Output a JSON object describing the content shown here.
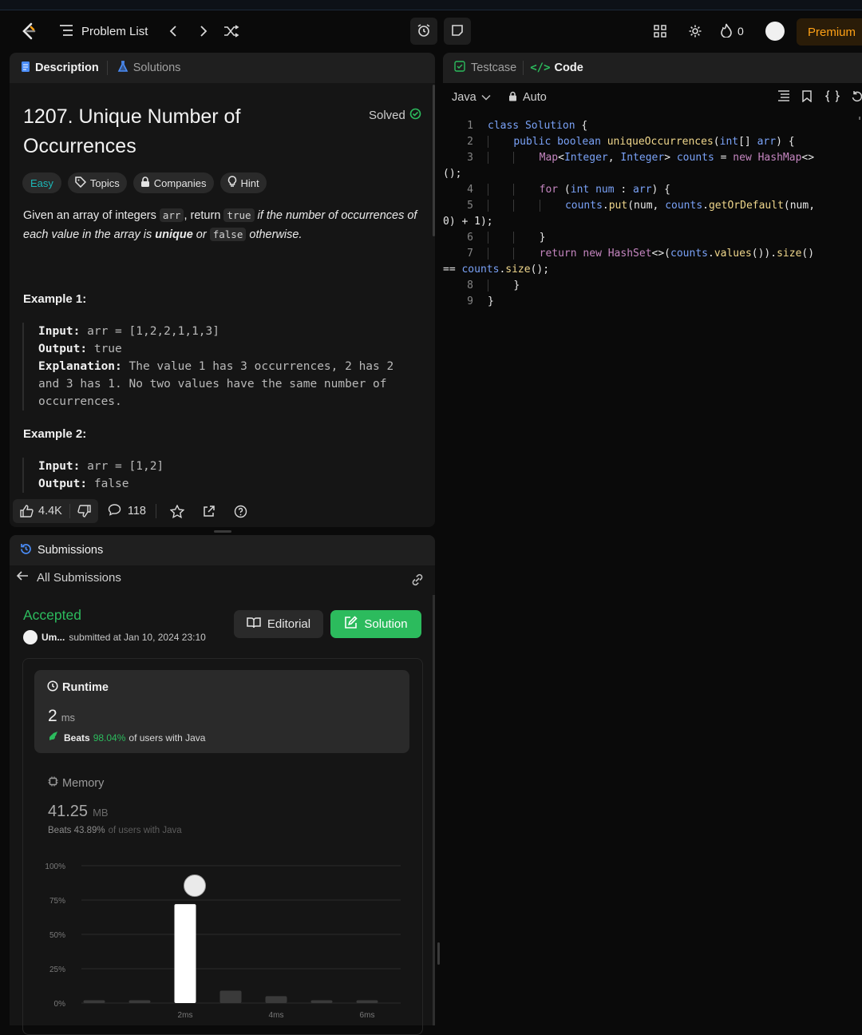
{
  "nav": {
    "problem_list": "Problem List",
    "streak_count": "0",
    "premium": "Premium"
  },
  "left_tabs": {
    "description": "Description",
    "solutions": "Solutions"
  },
  "problem": {
    "title": "1207. Unique Number of Occurrences",
    "status": "Solved",
    "difficulty": "Easy",
    "chips": [
      "Topics",
      "Companies",
      "Hint"
    ],
    "desc": {
      "p1": "Given an array of integers ",
      "c1": "arr",
      "p2": ", return ",
      "c2": "true",
      "p3": " if the number of occurrences of each value in the array is ",
      "p4": "unique",
      "p5": " or ",
      "c3": "false",
      "p6": " otherwise."
    },
    "examples": [
      {
        "heading": "Example 1:",
        "input_label": "Input:",
        "input": "arr = [1,2,2,1,1,3]",
        "output_label": "Output:",
        "output": "true",
        "expl_label": "Explanation:",
        "expl": "The value 1 has 3 occurrences, 2 has 2 and 3 has 1. No two values have the same number of occurrences."
      },
      {
        "heading": "Example 2:",
        "input_label": "Input:",
        "input": "arr = [1,2]",
        "output_label": "Output:",
        "output": "false"
      }
    ],
    "likes": "4.4K",
    "comments": "118"
  },
  "submissions": {
    "tab": "Submissions",
    "all": "All Submissions",
    "status": "Accepted",
    "user": "Um...",
    "submitted": "submitted at Jan 10, 2024 23:10",
    "editorial": "Editorial",
    "solution": "Solution",
    "runtime": {
      "label": "Runtime",
      "value": "2",
      "unit": "ms",
      "beats_label": "Beats",
      "beats_pct": "98.04%",
      "beats_suffix": "of users with Java"
    },
    "memory": {
      "label": "Memory",
      "value": "41.25",
      "unit": "MB",
      "beats": "Beats 43.89%",
      "beats_suffix": "of users with Java"
    }
  },
  "chart_data": {
    "type": "bar",
    "categories": [
      "",
      "",
      "2ms",
      "",
      "4ms",
      "",
      "6ms"
    ],
    "values": [
      2,
      2,
      72,
      9,
      5,
      2,
      2
    ],
    "highlight_index": 2,
    "ylim": [
      0,
      100
    ],
    "yticks": [
      "100%",
      "75%",
      "50%",
      "25%",
      "0%"
    ],
    "title": "",
    "xlabel": "",
    "ylabel": ""
  },
  "editor": {
    "tabs": {
      "testcase": "Testcase",
      "code": "Code"
    },
    "language": "Java",
    "mode": "Auto",
    "line_numbers": [
      "1",
      "2",
      "3",
      "",
      "4",
      "5",
      "",
      "6",
      "7",
      "",
      "8",
      "9"
    ]
  },
  "colors": {
    "accent_green": "#2cbb5d",
    "easy": "#1cb8b8",
    "premium": "#ffa116",
    "chart_bar": "#3a3a3a",
    "chart_highlight": "#ffffff"
  }
}
